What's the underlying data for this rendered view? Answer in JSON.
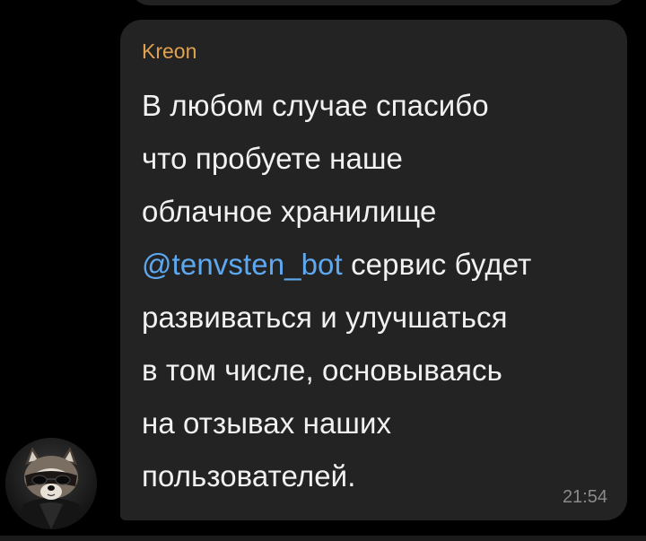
{
  "message": {
    "sender_name": "Kreon",
    "lines": [
      "В любом случае спасибо",
      "что пробуете наше",
      "облачное хранилище",
      "сервис будет",
      "развиваться и улучшаться",
      "в том числе, основываясь",
      "на отзывах наших",
      "пользователей."
    ],
    "mention": "@tenvsten_bot",
    "time": "21:54"
  },
  "avatar": {
    "description_icon": "raccoon-avatar-icon"
  },
  "colors": {
    "background": "#000000",
    "bubble": "#232323",
    "sender_name": "#e0a24f",
    "mention_link": "#5ea8f0",
    "text": "#f1f1f1",
    "time": "#8a8a8a"
  }
}
